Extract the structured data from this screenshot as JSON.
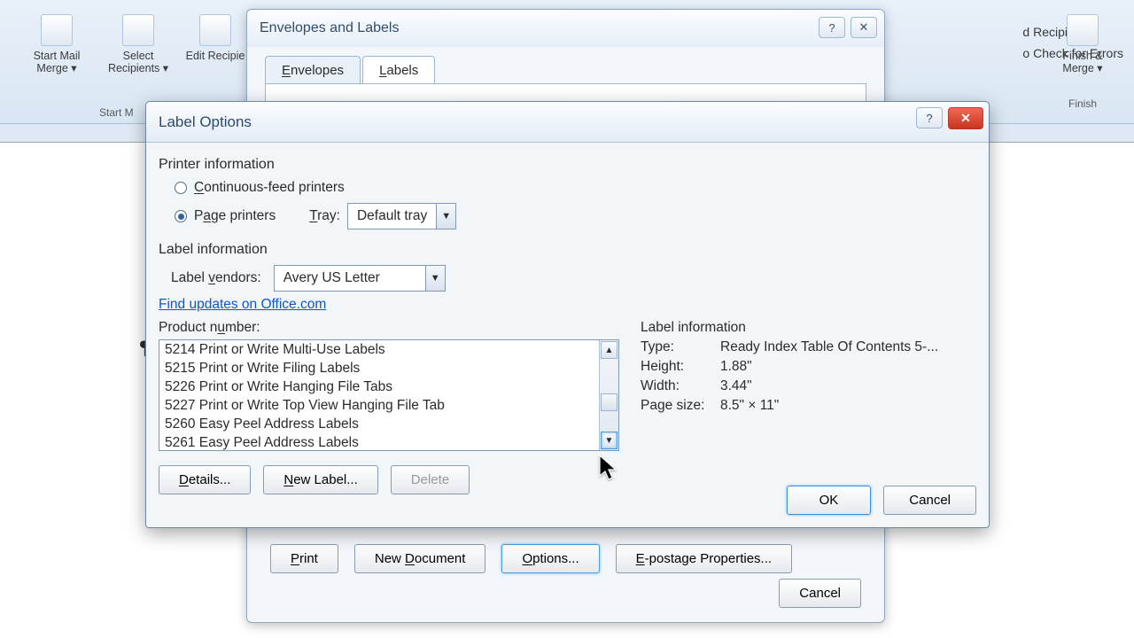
{
  "ribbon": {
    "start_mail_merge": "Start Mail\nMerge ▾",
    "select_recipients": "Select\nRecipients ▾",
    "edit_recipients": "Edit\nRecipie",
    "group_start": "Start M",
    "right": {
      "recipient": "d Recipient",
      "check_errors": "o Check for Errors",
      "finish_merge": "Finish &\nMerge ▾",
      "finish_group": "Finish"
    }
  },
  "dlg1": {
    "title": "Envelopes and Labels",
    "help": "?",
    "close": "✕",
    "tab_envelopes": "Envelopes",
    "tab_labels": "Labels",
    "btn_print": "Print",
    "btn_newdoc": "New Document",
    "btn_options": "Options...",
    "btn_epostage": "E-postage Properties...",
    "btn_cancel": "Cancel"
  },
  "dlg2": {
    "title": "Label Options",
    "help": "?",
    "printer_info_h": "Printer information",
    "radio_continuous": "Continuous-feed printers",
    "radio_page": "Page printers",
    "tray_label": "Tray:",
    "tray_value": "Default tray",
    "label_info_h": "Label information",
    "vendors_label": "Label vendors:",
    "vendors_value": "Avery US Letter",
    "find_updates": "Find updates on Office.com",
    "product_number_h": "Product number:",
    "items": [
      "5214 Print or Write Multi-Use Labels",
      "5215 Print or Write Filing Labels",
      "5226 Print or Write Hanging File Tabs",
      "5227 Print or Write Top View Hanging File Tab",
      "5260 Easy Peel Address Labels",
      "5261 Easy Peel Address Labels"
    ],
    "info_h": "Label information",
    "info": {
      "type_l": "Type:",
      "type_v": "Ready Index Table Of Contents 5-...",
      "height_l": "Height:",
      "height_v": "1.88\"",
      "width_l": "Width:",
      "width_v": "3.44\"",
      "page_l": "Page size:",
      "page_v": "8.5\" × 11\""
    },
    "btn_details": "Details...",
    "btn_newlabel": "New Label...",
    "btn_delete": "Delete",
    "btn_ok": "OK",
    "btn_cancel": "Cancel"
  }
}
